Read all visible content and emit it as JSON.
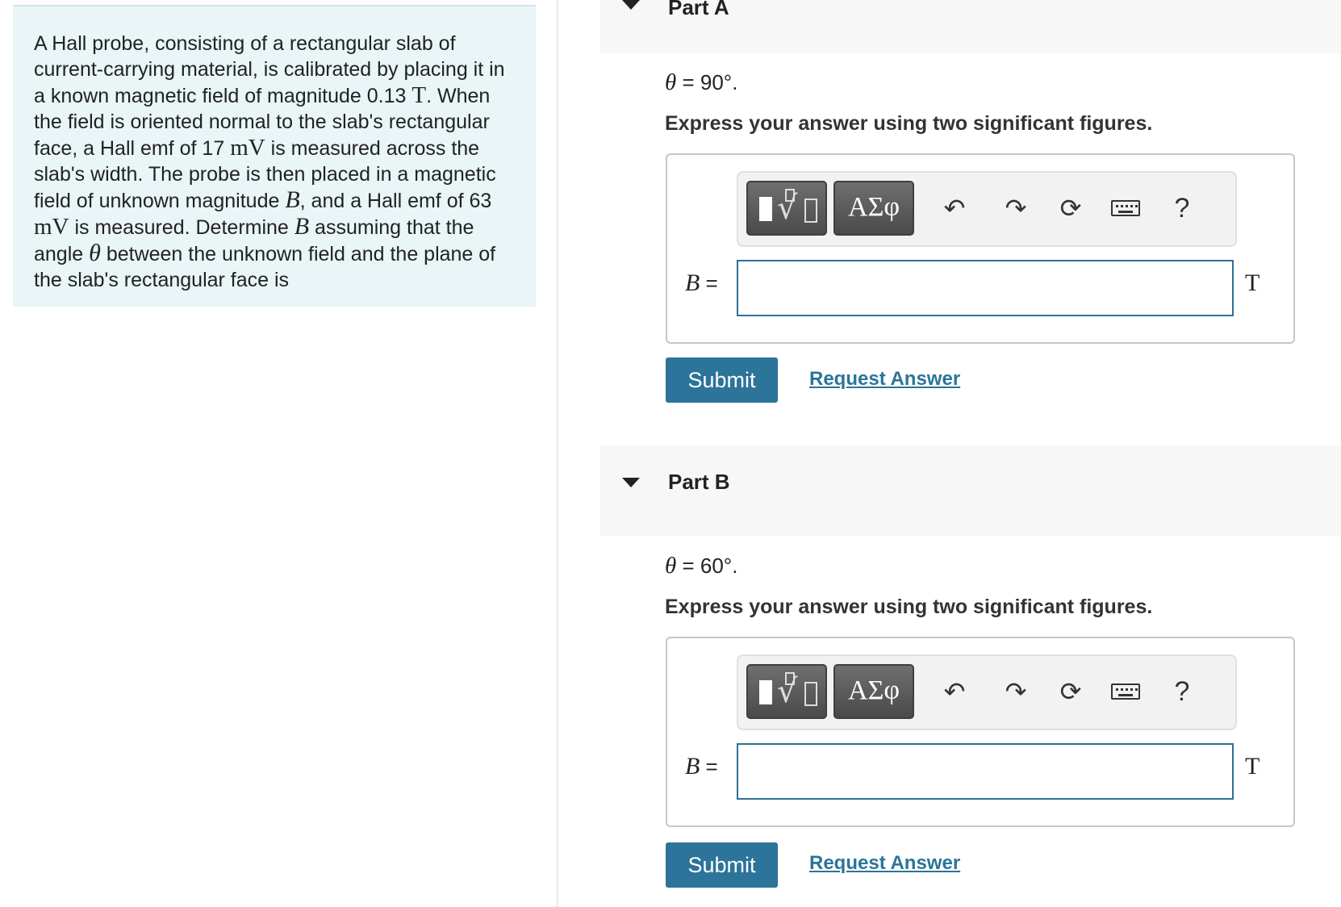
{
  "problem": {
    "t1": "A Hall probe, consisting of a rectangular slab of current-carrying material, is calibrated by placing it in a known magnetic field of magnitude 0.13 ",
    "t1_unit": "T",
    "t2": ". When the field is oriented normal to the slab's rectangular face, a Hall emf of 17 ",
    "t2_unit": "mV",
    "t3": " is measured across the slab's width. The probe is then placed in a magnetic field of unknown magnitude ",
    "t3_var": "B",
    "t4": ", and a Hall emf of 63 ",
    "t4_unit": "mV",
    "t5": " is measured. Determine ",
    "t5_var": "B",
    "t6": " assuming that the angle ",
    "t6_var": "θ",
    "t7": " between the unknown field and the plane of the slab's rectangular face is"
  },
  "parts": [
    {
      "title": "Part A",
      "theta_var": "θ",
      "theta_value": " = 90°.",
      "instruction": "Express your answer using two significant figures.",
      "variable": "B",
      "equals": " =",
      "input_value": "",
      "unit": "T",
      "submit": "Submit",
      "request": "Request Answer"
    },
    {
      "title": "Part B",
      "theta_var": "θ",
      "theta_value": " = 60°.",
      "instruction": "Express your answer using two significant figures.",
      "variable": "B",
      "equals": " =",
      "input_value": "",
      "unit": "T",
      "submit": "Submit",
      "request": "Request Answer"
    }
  ],
  "toolbar": {
    "symbols_label": "ΑΣφ",
    "undo_icon": "undo-icon",
    "redo_icon": "redo-icon",
    "reset_icon": "reset-icon",
    "keyboard_icon": "keyboard-icon",
    "help_label": "?"
  },
  "colors": {
    "accent": "#2c7499",
    "problem_bg": "#e9f5f7",
    "header_bg": "#f7f7f7"
  }
}
